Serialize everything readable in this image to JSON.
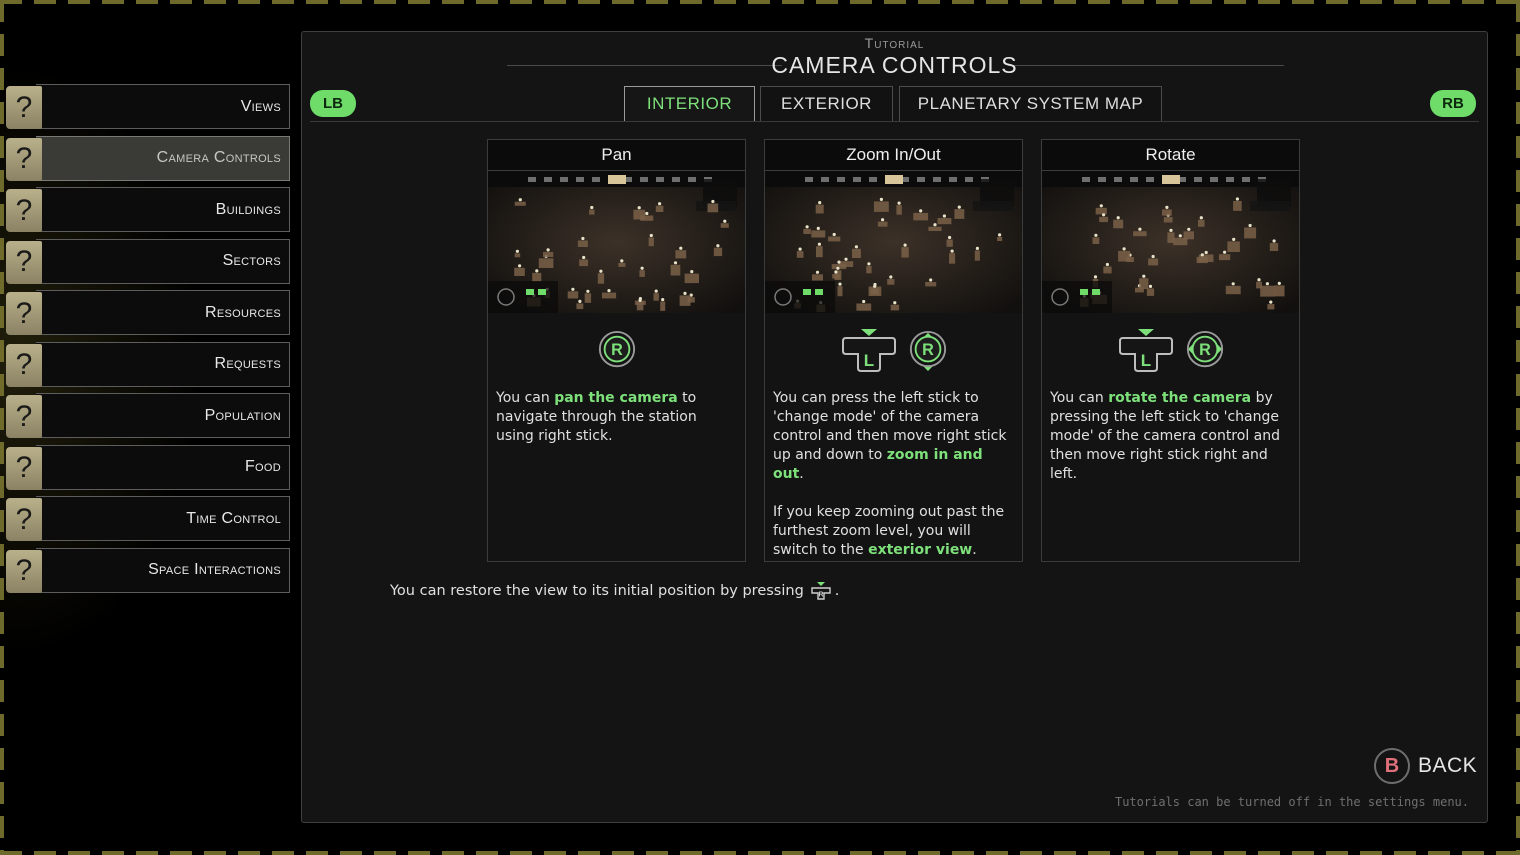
{
  "sidebar": {
    "items": [
      {
        "icon": "question-icon",
        "label": "Views",
        "active": false
      },
      {
        "icon": "question-icon",
        "label": "Camera Controls",
        "active": true
      },
      {
        "icon": "question-icon",
        "label": "Buildings",
        "active": false
      },
      {
        "icon": "question-icon",
        "label": "Sectors",
        "active": false
      },
      {
        "icon": "question-icon",
        "label": "Resources",
        "active": false
      },
      {
        "icon": "question-icon",
        "label": "Requests",
        "active": false
      },
      {
        "icon": "question-icon",
        "label": "Population",
        "active": false
      },
      {
        "icon": "question-icon",
        "label": "Food",
        "active": false
      },
      {
        "icon": "question-icon",
        "label": "Time Control",
        "active": false
      },
      {
        "icon": "question-icon",
        "label": "Space Interactions",
        "active": false
      }
    ],
    "badge_glyph": "?"
  },
  "header": {
    "kicker": "Tutorial",
    "title": "CAMERA CONTROLS",
    "lb_label": "LB",
    "rb_label": "RB"
  },
  "tabs": [
    {
      "label": "INTERIOR",
      "active": true
    },
    {
      "label": "EXTERIOR",
      "active": false
    },
    {
      "label": "PLANETARY SYSTEM MAP",
      "active": false
    }
  ],
  "cards": [
    {
      "title": "Pan",
      "icons": [
        "right-stick-icon"
      ],
      "text": [
        [
          {
            "t": "You can "
          },
          {
            "t": "pan the camera",
            "hl": true
          },
          {
            "t": " to navigate through the station using right stick."
          }
        ]
      ]
    },
    {
      "title": "Zoom In/Out",
      "icons": [
        "left-stick-press-icon",
        "right-stick-vertical-icon"
      ],
      "text": [
        [
          {
            "t": "You can press the left stick to 'change mode' of the camera control and then move right stick up and down to "
          },
          {
            "t": "zoom in and out",
            "hl": true
          },
          {
            "t": "."
          }
        ],
        [
          {
            "t": "If you keep zooming out past the furthest zoom level, you will switch to the "
          },
          {
            "t": "exterior view",
            "hl": true
          },
          {
            "t": "."
          }
        ]
      ]
    },
    {
      "title": "Rotate",
      "icons": [
        "left-stick-press-icon",
        "right-stick-horizontal-icon"
      ],
      "text": [
        [
          {
            "t": "You can "
          },
          {
            "t": "rotate the camera",
            "hl": true
          },
          {
            "t": " by pressing the left stick to 'change mode' of the camera control and then move right stick right and left."
          }
        ]
      ]
    }
  ],
  "stick_letters": {
    "left": "L",
    "right": "R"
  },
  "restore_text": "You can restore the view to its initial position by pressing",
  "restore_suffix": ".",
  "back": {
    "key": "B",
    "label": "BACK"
  },
  "footnote": "Tutorials can be turned off in the settings menu.",
  "colors": {
    "accent": "#7de07a",
    "bumper": "#6fdc6a",
    "badge": "#a79f7c",
    "back_key": "#e0707a"
  }
}
